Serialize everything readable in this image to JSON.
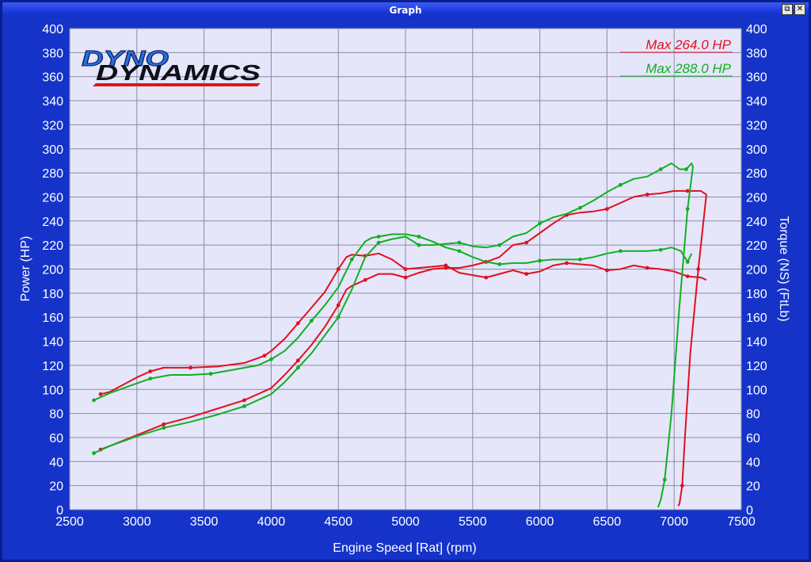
{
  "window": {
    "title": "Graph",
    "restore_glyph": "⧉",
    "close_glyph": "✕"
  },
  "logo": {
    "line1": "DYNO",
    "line2": "DYNAMICS"
  },
  "chart_data": {
    "type": "line",
    "xlabel": "Engine Speed [Rat] (rpm)",
    "ylabel_left": "Power (HP)",
    "ylabel_right": "Torque (NS) (FtLb)",
    "xlim": [
      2500,
      7500
    ],
    "ylim": [
      0,
      400
    ],
    "x_ticks": [
      2500,
      3000,
      3500,
      4000,
      4500,
      5000,
      5500,
      6000,
      6500,
      7000,
      7500
    ],
    "y_ticks": [
      0,
      20,
      40,
      60,
      80,
      100,
      120,
      140,
      160,
      180,
      200,
      220,
      240,
      260,
      280,
      300,
      320,
      340,
      360,
      380,
      400
    ],
    "grid": true,
    "legend_position": "top-right",
    "legend": [
      {
        "label": "Max 264.0 HP",
        "color": "#e01020"
      },
      {
        "label": "Max 288.0 HP",
        "color": "#10b020"
      }
    ],
    "series": [
      {
        "name": "Max 264.0 HP",
        "role": "power",
        "color": "#e01020",
        "x": [
          2730,
          2800,
          3000,
          3200,
          3400,
          3600,
          3800,
          4000,
          4100,
          4200,
          4300,
          4400,
          4500,
          4560,
          4600,
          4700,
          4800,
          4900,
          5000,
          5100,
          5200,
          5300,
          5400,
          5500,
          5600,
          5700,
          5800,
          5900,
          6000,
          6100,
          6200,
          6300,
          6400,
          6500,
          6600,
          6700,
          6800,
          6900,
          7000,
          7100,
          7200,
          7240,
          7180,
          7120,
          7080,
          7060,
          7040,
          7030
        ],
        "y": [
          50,
          53,
          62,
          71,
          77,
          84,
          91,
          101,
          112,
          124,
          137,
          152,
          170,
          183,
          186,
          191,
          196,
          196,
          193,
          197,
          200,
          201,
          201,
          203,
          206,
          210,
          220,
          222,
          230,
          238,
          245,
          247,
          248,
          250,
          255,
          260,
          262,
          263,
          265,
          265,
          265,
          262,
          200,
          130,
          60,
          20,
          5,
          3
        ]
      },
      {
        "name": "Max 264.0 HP",
        "role": "torque",
        "color": "#e01020",
        "x": [
          2730,
          2800,
          3000,
          3100,
          3200,
          3300,
          3400,
          3600,
          3800,
          3950,
          4000,
          4100,
          4200,
          4300,
          4400,
          4500,
          4560,
          4600,
          4700,
          4800,
          4900,
          5000,
          5100,
          5200,
          5300,
          5400,
          5500,
          5600,
          5700,
          5800,
          5900,
          6000,
          6100,
          6200,
          6300,
          6400,
          6500,
          6600,
          6700,
          6800,
          6900,
          7000,
          7100,
          7200,
          7240
        ],
        "y": [
          96,
          98,
          110,
          115,
          118,
          118,
          118,
          119,
          122,
          128,
          132,
          142,
          155,
          168,
          181,
          200,
          210,
          212,
          211,
          213,
          208,
          200,
          201,
          202,
          203,
          197,
          195,
          193,
          196,
          199,
          196,
          198,
          203,
          205,
          204,
          203,
          199,
          200,
          203,
          201,
          200,
          198,
          194,
          193,
          191
        ]
      },
      {
        "name": "Max 288.0 HP",
        "role": "power",
        "color": "#10b020",
        "x": [
          2680,
          2800,
          3000,
          3200,
          3400,
          3600,
          3800,
          4000,
          4100,
          4200,
          4300,
          4400,
          4500,
          4600,
          4700,
          4800,
          4900,
          5000,
          5100,
          5200,
          5300,
          5400,
          5500,
          5600,
          5700,
          5800,
          5900,
          6000,
          6100,
          6200,
          6300,
          6400,
          6500,
          6600,
          6700,
          6800,
          6900,
          6980,
          7040,
          7090,
          7130,
          7140,
          7100,
          7040,
          6980,
          6930,
          6900,
          6880
        ],
        "y": [
          47,
          53,
          61,
          68,
          73,
          79,
          86,
          96,
          106,
          118,
          130,
          145,
          160,
          183,
          210,
          222,
          225,
          227,
          220,
          220,
          221,
          222,
          219,
          218,
          220,
          227,
          230,
          238,
          243,
          246,
          251,
          257,
          264,
          270,
          275,
          277,
          283,
          288,
          283,
          283,
          288,
          285,
          250,
          170,
          80,
          25,
          8,
          2
        ]
      },
      {
        "name": "Max 288.0 HP",
        "role": "torque",
        "color": "#10b020",
        "x": [
          2680,
          2800,
          2950,
          3100,
          3250,
          3400,
          3550,
          3750,
          3900,
          4000,
          4100,
          4200,
          4300,
          4400,
          4500,
          4600,
          4700,
          4750,
          4800,
          4900,
          5000,
          5100,
          5200,
          5300,
          5400,
          5500,
          5600,
          5700,
          5800,
          5900,
          6000,
          6100,
          6200,
          6300,
          6400,
          6500,
          6600,
          6700,
          6800,
          6900,
          6980,
          7050,
          7100,
          7130
        ],
        "y": [
          91,
          97,
          103,
          109,
          112,
          112,
          113,
          117,
          120,
          125,
          132,
          143,
          157,
          170,
          185,
          208,
          223,
          226,
          227,
          229,
          229,
          227,
          223,
          218,
          215,
          210,
          206,
          204,
          205,
          205,
          207,
          208,
          208,
          208,
          210,
          213,
          215,
          215,
          215,
          216,
          218,
          215,
          206,
          213
        ]
      }
    ]
  }
}
